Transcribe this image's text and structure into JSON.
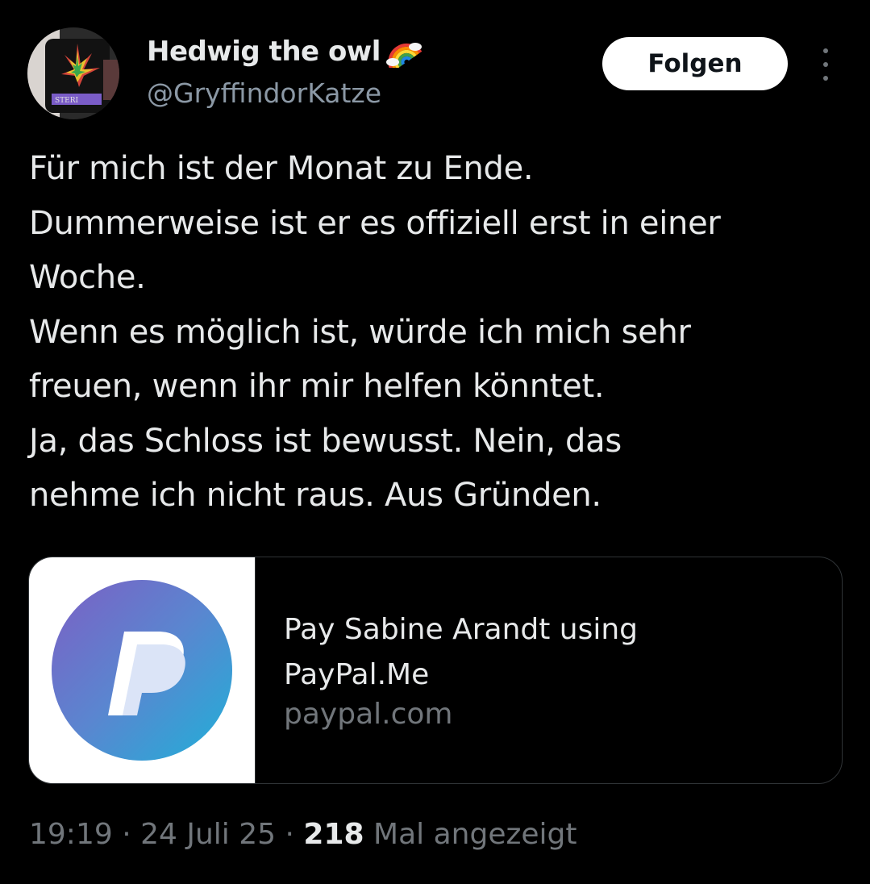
{
  "author": {
    "display_name": "Hedwig the owl",
    "handle": "@GryffindorKatze",
    "avatar_icon": "mug-with-leaf-avatar",
    "name_emoji": "rainbow-icon"
  },
  "actions": {
    "follow_label": "Folgen",
    "more_icon": "more-vertical-icon"
  },
  "tweet": {
    "lines": [
      "Für mich ist der Monat zu Ende.",
      "Dummerweise ist er es offiziell erst in einer",
      "Woche.",
      "Wenn es möglich ist, würde ich mich sehr",
      "freuen, wenn ihr mir helfen könntet.",
      "Ja, das Schloss ist bewusst. Nein, das",
      "nehme ich nicht raus. Aus Gründen."
    ]
  },
  "link_card": {
    "title_line1": "Pay Sabine Arandt using",
    "title_line2": "PayPal.Me",
    "domain": "paypal.com",
    "logo_icon": "paypal-logo-icon"
  },
  "meta": {
    "time": "19:19",
    "separator": "·",
    "date": "24 Juli 25",
    "view_count": "218",
    "views_label": "Mal angezeigt"
  },
  "colors": {
    "background": "#000000",
    "text": "#e7e9ea",
    "secondary": "#71767b",
    "border": "#2f3336",
    "button_bg": "#ffffff"
  }
}
